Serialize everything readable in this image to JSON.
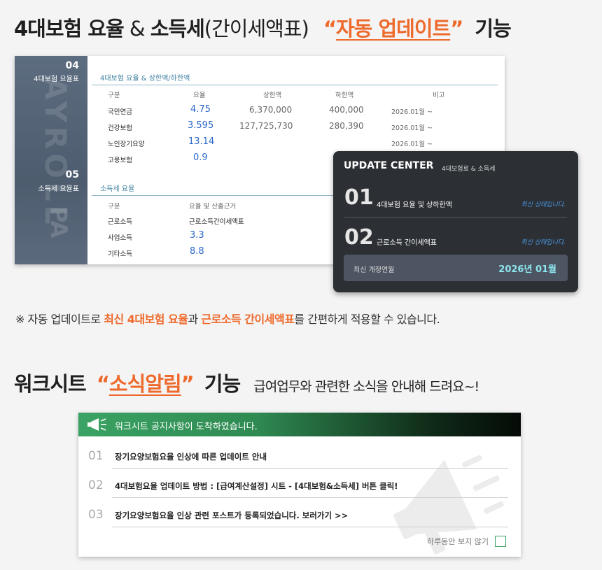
{
  "heading1": {
    "part1": "4대보험 요율",
    "amp": " & ",
    "part2": "소득세",
    "paren": "(간이세액표)",
    "q_open": "“",
    "highlight": "자동 업데이트",
    "q_close": "”",
    "tail": "기능"
  },
  "panel": {
    "side": {
      "num1": "04",
      "label1": "4대보험 요율표",
      "num2": "05",
      "label2": "소득세 요율표",
      "watermark": "AYROLL",
      "watermark2": "PA"
    },
    "sec1_title": "4대보험 요율 & 상한액/하한액",
    "sec1_headers": [
      "구분",
      "요율",
      "상한액",
      "하한액",
      "비고"
    ],
    "sec1_rows": [
      {
        "label": "국민연금",
        "rate": "4.75",
        "upper": "6,370,000",
        "lower": "400,000",
        "note": "2026.01월 ~"
      },
      {
        "label": "건강보험",
        "rate": "3.595",
        "upper": "127,725,730",
        "lower": "280,390",
        "note": "2026.01월 ~"
      },
      {
        "label": "노인장기요양",
        "rate": "13.14",
        "upper": "",
        "lower": "",
        "note": "2026.01월 ~"
      },
      {
        "label": "고용보험",
        "rate": "0.9",
        "upper": "",
        "lower": "",
        "note": ""
      }
    ],
    "sec2_title": "소득세 요율",
    "sec2_headers": [
      "구분",
      "요율 및 산출근거"
    ],
    "sec2_rows": [
      {
        "label": "근로소득",
        "value": "근로소득간이세액표"
      },
      {
        "label": "사업소득",
        "value": "3.3"
      },
      {
        "label": "기타소득",
        "value": "8.8"
      }
    ]
  },
  "update_center": {
    "title": "UPDATE CENTER",
    "subtitle": "4대보험료 & 소득세",
    "items": [
      {
        "num": "01",
        "label": "4대보험 요율 및 상하한액",
        "status": "최신 상태입니다."
      },
      {
        "num": "02",
        "label": "근로소득 간이세액표",
        "status": "최신 상태입니다."
      }
    ],
    "latest_label": "최신 개정연월",
    "latest_value": "2026년 01월"
  },
  "note": {
    "prefix": "※ 자동 업데이트로 ",
    "hl1": "최신 4대보험 요율",
    "mid": "과 ",
    "hl2": "근로소득 간이세액표",
    "suffix": "를 간편하게 적용할 수 있습니다."
  },
  "heading2": {
    "part1": "워크시트",
    "q_open": "“",
    "highlight": "소식알림",
    "q_close": "”",
    "tail": "기능",
    "sub": "급여업무와 관련한 소식을 안내해 드려요~!"
  },
  "notice": {
    "header": "워크시트 공지사항이 도착하였습니다.",
    "items": [
      {
        "num": "01",
        "text": "장기요양보험요율 인상에 따른 업데이트 안내"
      },
      {
        "num": "02",
        "text": "4대보험요율 업데이트 방법 : [급여계산설정] 시트 - [4대보험&소득세] 버튼 클릭!"
      },
      {
        "num": "03",
        "text": "장기요양보험요율 인상 관련 포스트가 등록되었습니다. 보러가기 >>"
      }
    ],
    "hide_label": "하루동안 보지 않기"
  },
  "colors": {
    "accent": "#ee6a2c",
    "blue_value": "#2b68c9",
    "green": "#3aa363",
    "dark_panel": "#2c2f34",
    "status_blue": "#4a9be8",
    "latest_cyan": "#8ee6ee"
  }
}
